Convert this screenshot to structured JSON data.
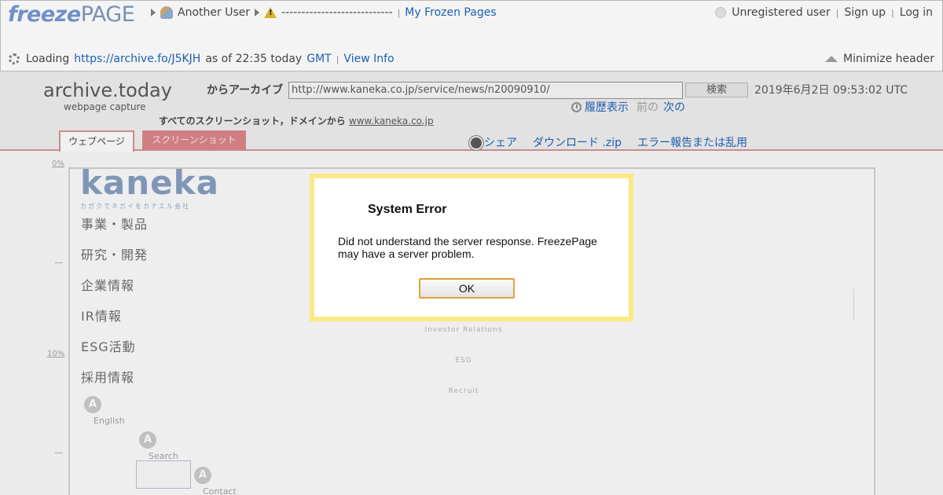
{
  "freezepage": {
    "logo_freeze": "freeze",
    "logo_page": "PAGE",
    "crumb_user": "Another User",
    "crumb_title": "----------------------------",
    "crumb_separator": "|",
    "my_pages_link": "My Frozen Pages",
    "unregistered": "Unregistered user",
    "signup": "Sign up",
    "login": "Log in",
    "loading_prefix": "Loading",
    "loading_url": "https://archive.fo/J5KJH",
    "loading_as_of": "as of 22:35 today",
    "loading_tz": "GMT",
    "view_info": "View Info",
    "minimize": "Minimize header"
  },
  "archive": {
    "title": "archive.today",
    "subtitle": "webpage capture",
    "from_label": "からアーカイブ",
    "url_value": "http://www.kaneka.co.jp/service/news/n20090910/",
    "search_button": "検索",
    "date": "2019年6月2日 09:53:02 UTC",
    "history": "履歴表示",
    "prev": "前の",
    "next": "次の",
    "all_screenshots_prefix": "すべてのスクリーンショット，ドメインから",
    "domain_link": "www.kaneka.co.jp",
    "tab_webpage": "ウェブページ",
    "tab_screenshot": "スクリーンショット",
    "share": "シェア",
    "download": "ダウンロード .zip",
    "report": "エラー報告または乱用"
  },
  "ruler": {
    "label_0": "0%",
    "label_10": "10%"
  },
  "kaneka": {
    "logo_word": "kaneka",
    "logo_tagline": "カガクでネガイをカナエル会社",
    "nav": [
      "事業・製品",
      "研究・開発",
      "企業情報",
      "IR情報",
      "ESG活動",
      "採用情報"
    ],
    "sub_ir": "Investor Relations",
    "sub_esg": "ESG",
    "sub_recruit": "Recruit",
    "a_letter": "A",
    "english": "English",
    "search": "Search",
    "contact": "Contact"
  },
  "modal": {
    "title": "System Error",
    "message": "Did not understand the server response. FreezePage may have a server problem.",
    "ok": "OK"
  },
  "colors": {
    "modal_border": "#fbe986",
    "ok_border": "#e0a23a",
    "tab_screenshot_bg": "#cf7f82",
    "link": "#1d5fb0"
  }
}
